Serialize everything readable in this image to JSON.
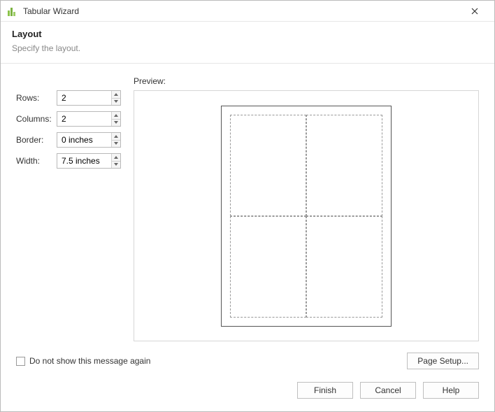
{
  "window": {
    "title": "Tabular Wizard"
  },
  "header": {
    "title": "Layout",
    "description": "Specify the layout."
  },
  "controls": {
    "rows": {
      "label": "Rows:",
      "value": "2"
    },
    "columns": {
      "label": "Columns:",
      "value": "2"
    },
    "border": {
      "label": "Border:",
      "value": "0 inches"
    },
    "width": {
      "label": "Width:",
      "value": "7.5 inches"
    }
  },
  "preview": {
    "label": "Preview:"
  },
  "options": {
    "dontshow_label": "Do not show this message again",
    "dontshow_checked": false,
    "page_setup_label": "Page Setup..."
  },
  "footer": {
    "finish": "Finish",
    "cancel": "Cancel",
    "help": "Help"
  }
}
